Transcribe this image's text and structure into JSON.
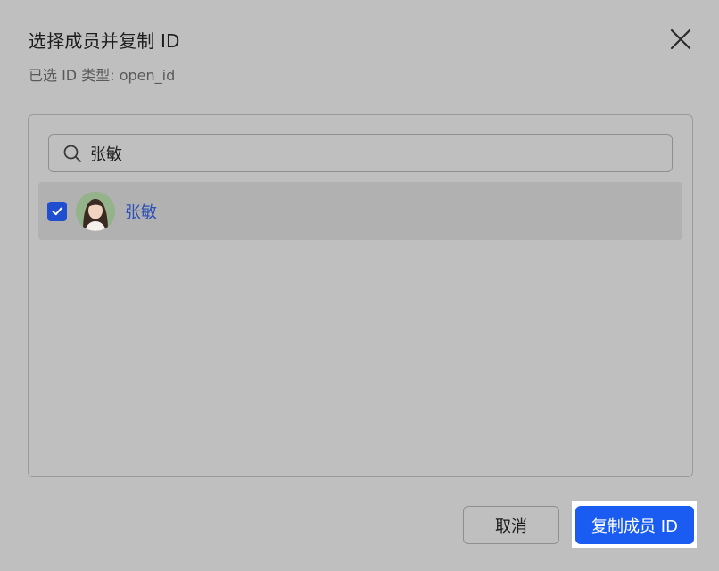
{
  "dialog": {
    "title": "选择成员并复制 ID",
    "subtitle": "已选 ID 类型: open_id"
  },
  "search": {
    "value": "张敏",
    "placeholder": ""
  },
  "members": [
    {
      "name": "张敏",
      "checked": true
    }
  ],
  "footer": {
    "cancel_label": "取消",
    "confirm_label": "复制成员 ID"
  },
  "colors": {
    "accent": "#1a5cf2",
    "checkbox": "#1f4fcf",
    "member_name": "#2b4fb8"
  }
}
